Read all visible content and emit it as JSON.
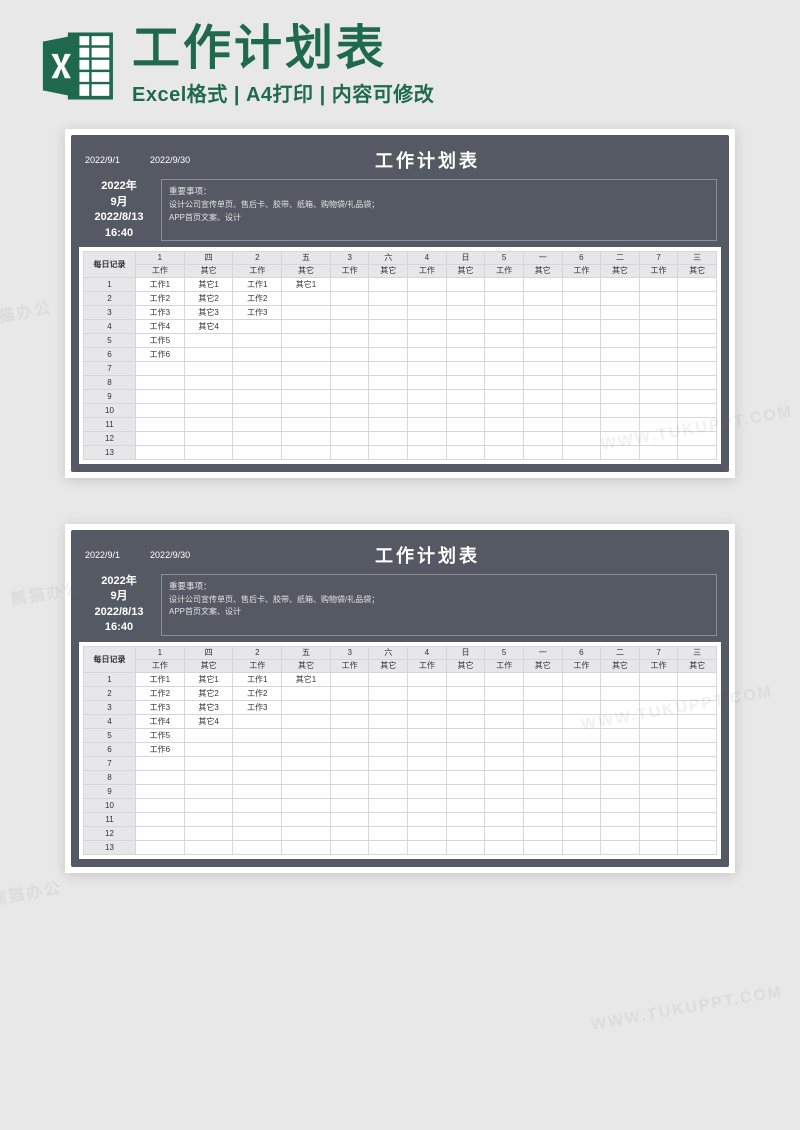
{
  "header": {
    "title": "工作计划表",
    "subtitle": "Excel格式 | A4打印 | 内容可修改"
  },
  "sheet": {
    "date_from": "2022/9/1",
    "date_to": "2022/9/30",
    "title": "工作计划表",
    "year_month_line1": "2022年",
    "year_month_line2": "9月",
    "datetime_line1": "2022/8/13",
    "datetime_line2": "16:40",
    "important_label": "重要事项：",
    "important_line1": "设计公司宣传单页、售后卡、胶带、纸箱、购物袋/礼品袋；",
    "important_line2": "APP首页文案、设计",
    "daily_label": "每日记录",
    "days": [
      {
        "num": "1",
        "dow": "四"
      },
      {
        "num": "2",
        "dow": "五"
      },
      {
        "num": "3",
        "dow": "六"
      },
      {
        "num": "4",
        "dow": "日"
      },
      {
        "num": "5",
        "dow": "一"
      },
      {
        "num": "6",
        "dow": "二"
      },
      {
        "num": "7",
        "dow": "三"
      }
    ],
    "col_work": "工作",
    "col_other": "其它",
    "rows": [
      {
        "n": "1",
        "cells": [
          "工作1",
          "其它1",
          "工作1",
          "其它1",
          "",
          "",
          "",
          "",
          "",
          "",
          "",
          "",
          "",
          ""
        ]
      },
      {
        "n": "2",
        "cells": [
          "工作2",
          "其它2",
          "工作2",
          "",
          "",
          "",
          "",
          "",
          "",
          "",
          "",
          "",
          "",
          ""
        ]
      },
      {
        "n": "3",
        "cells": [
          "工作3",
          "其它3",
          "工作3",
          "",
          "",
          "",
          "",
          "",
          "",
          "",
          "",
          "",
          "",
          ""
        ]
      },
      {
        "n": "4",
        "cells": [
          "工作4",
          "其它4",
          "",
          "",
          "",
          "",
          "",
          "",
          "",
          "",
          "",
          "",
          "",
          ""
        ]
      },
      {
        "n": "5",
        "cells": [
          "工作5",
          "",
          "",
          "",
          "",
          "",
          "",
          "",
          "",
          "",
          "",
          "",
          "",
          ""
        ]
      },
      {
        "n": "6",
        "cells": [
          "工作6",
          "",
          "",
          "",
          "",
          "",
          "",
          "",
          "",
          "",
          "",
          "",
          "",
          ""
        ]
      },
      {
        "n": "7",
        "cells": [
          "",
          "",
          "",
          "",
          "",
          "",
          "",
          "",
          "",
          "",
          "",
          "",
          "",
          ""
        ]
      },
      {
        "n": "8",
        "cells": [
          "",
          "",
          "",
          "",
          "",
          "",
          "",
          "",
          "",
          "",
          "",
          "",
          "",
          ""
        ]
      },
      {
        "n": "9",
        "cells": [
          "",
          "",
          "",
          "",
          "",
          "",
          "",
          "",
          "",
          "",
          "",
          "",
          "",
          ""
        ]
      },
      {
        "n": "10",
        "cells": [
          "",
          "",
          "",
          "",
          "",
          "",
          "",
          "",
          "",
          "",
          "",
          "",
          "",
          ""
        ]
      },
      {
        "n": "11",
        "cells": [
          "",
          "",
          "",
          "",
          "",
          "",
          "",
          "",
          "",
          "",
          "",
          "",
          "",
          ""
        ]
      },
      {
        "n": "12",
        "cells": [
          "",
          "",
          "",
          "",
          "",
          "",
          "",
          "",
          "",
          "",
          "",
          "",
          "",
          ""
        ]
      },
      {
        "n": "13",
        "cells": [
          "",
          "",
          "",
          "",
          "",
          "",
          "",
          "",
          "",
          "",
          "",
          "",
          "",
          ""
        ]
      }
    ]
  },
  "watermarks": [
    "熊猫办公",
    "WWW.TUKUPPT.COM"
  ]
}
